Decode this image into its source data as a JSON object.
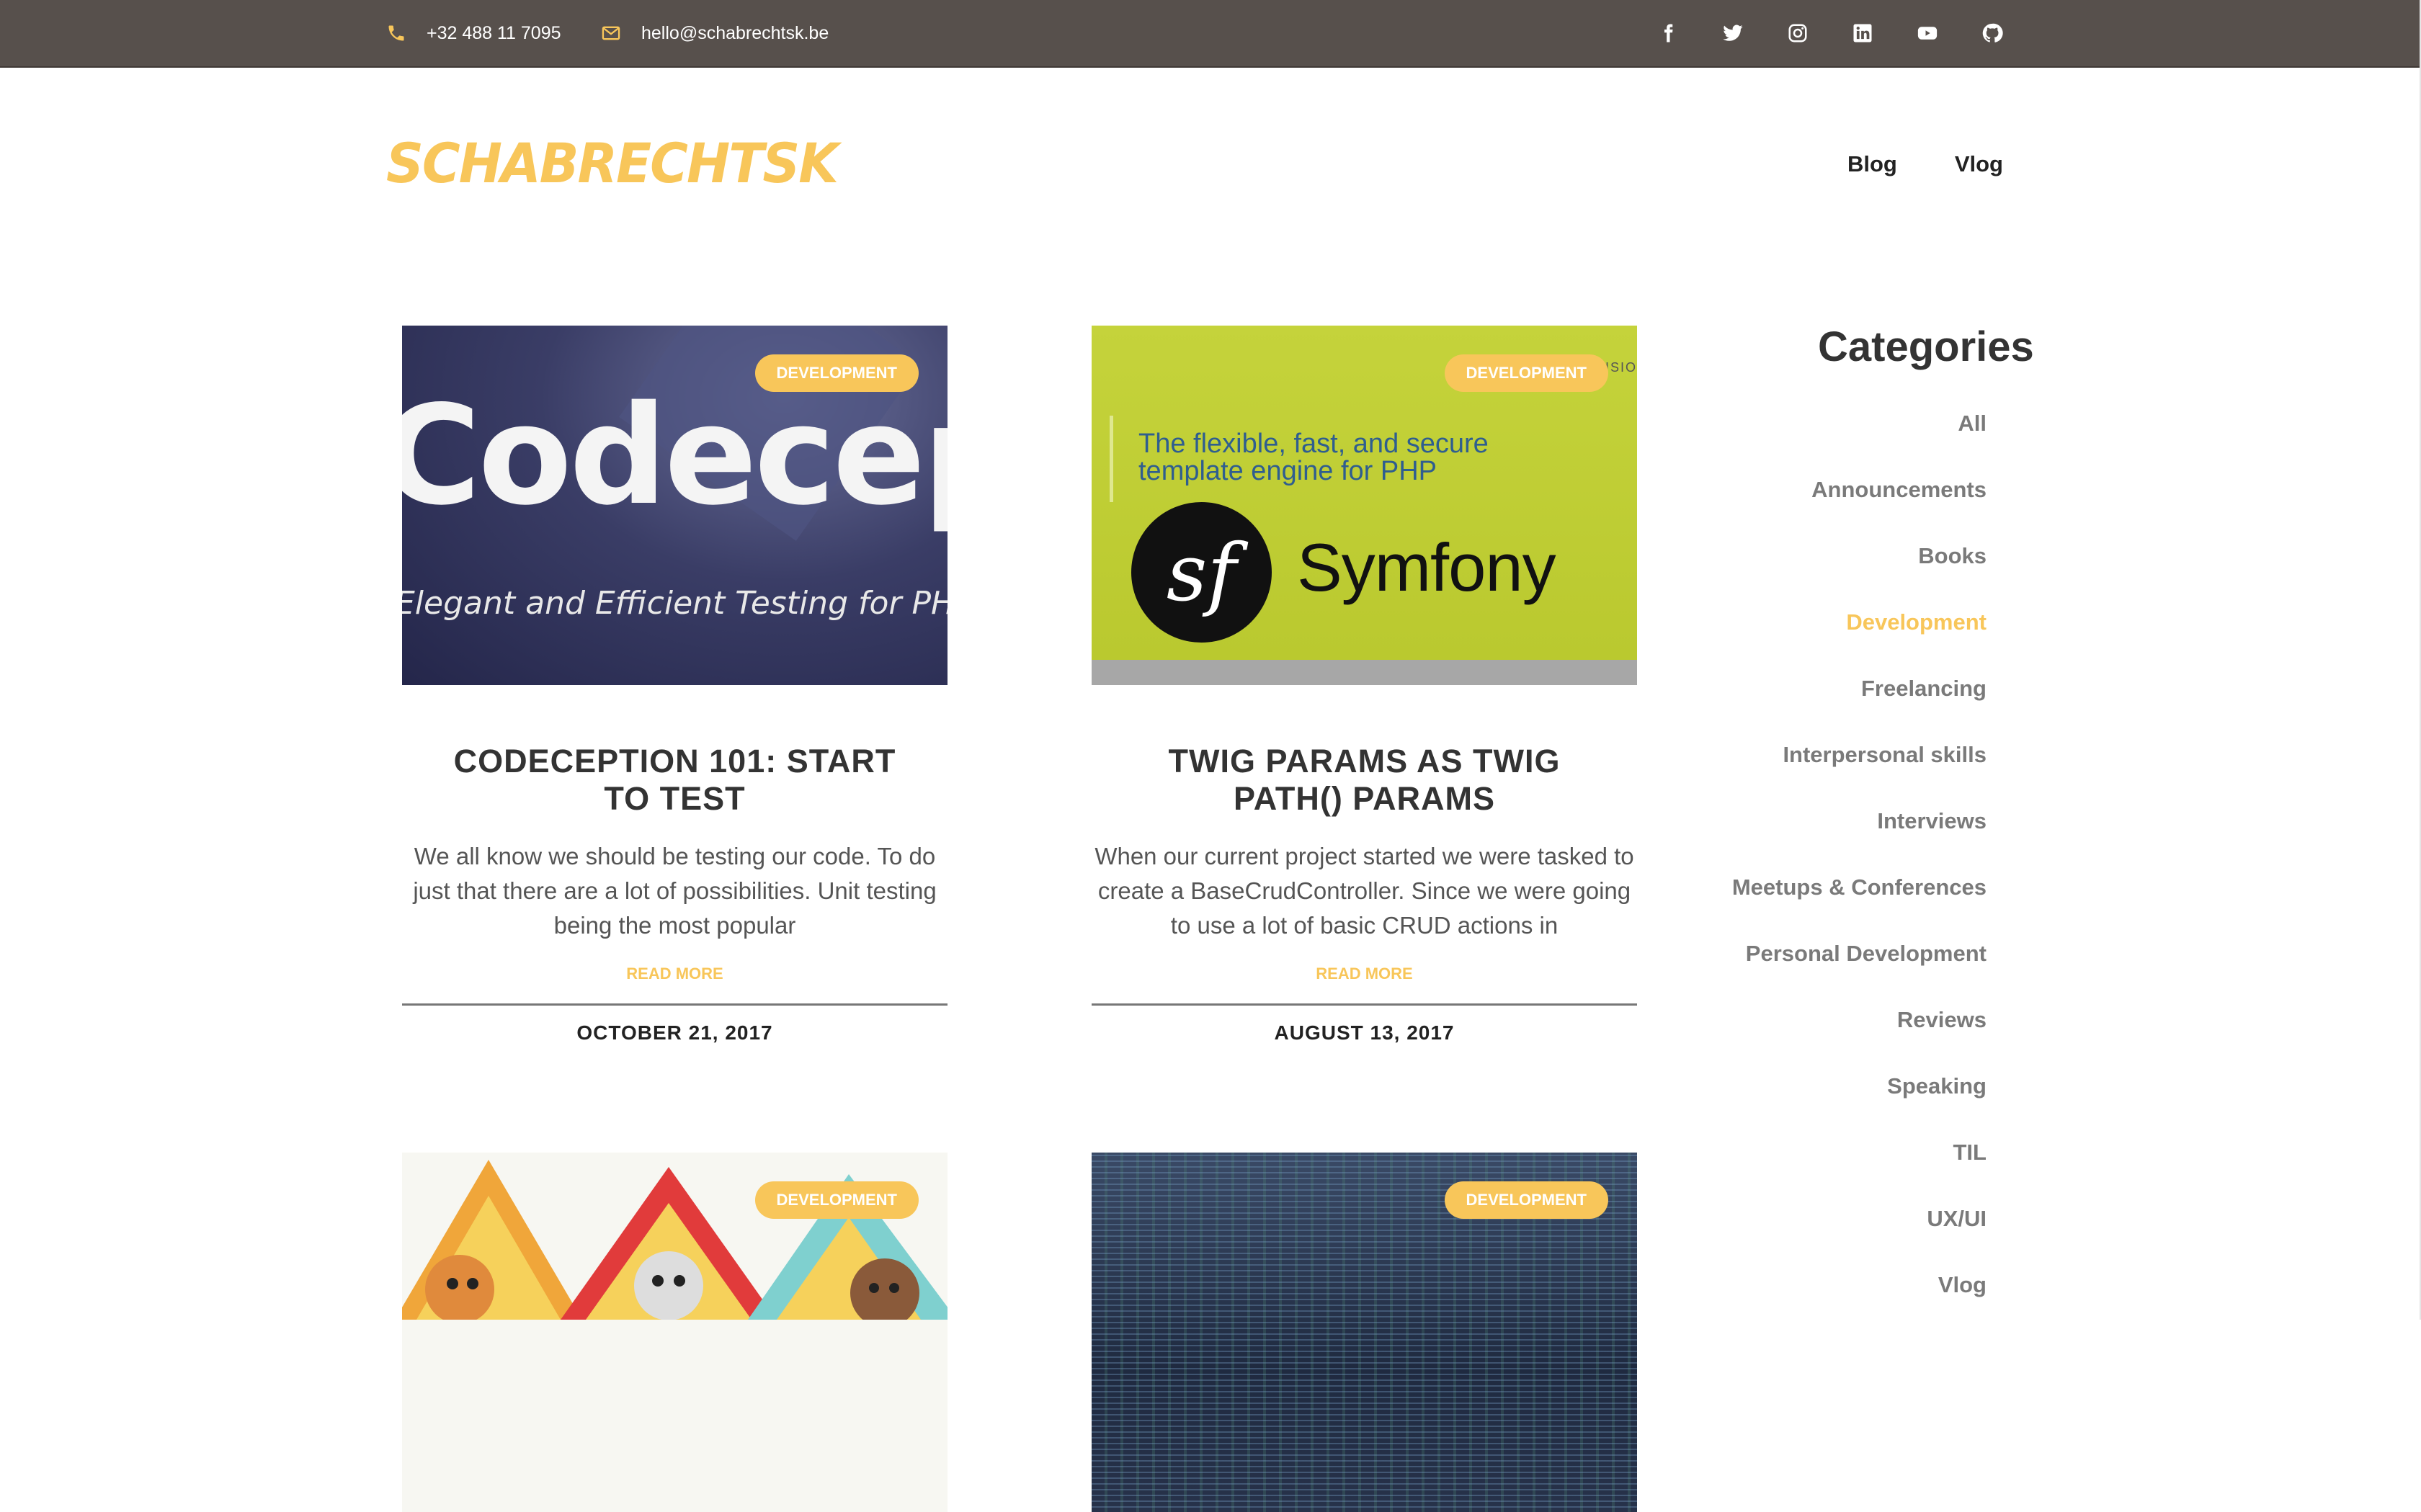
{
  "topbar": {
    "phone": "+32 488 11 7095",
    "email": "hello@schabrechtsk.be",
    "accent_color": "#f8c65a",
    "background_color": "#57504c",
    "social_icons": [
      "facebook-icon",
      "twitter-icon",
      "instagram-icon",
      "linkedin-icon",
      "youtube-icon",
      "github-icon"
    ]
  },
  "header": {
    "logo": "SCHABRECHTSK",
    "nav": [
      {
        "label": "Blog"
      },
      {
        "label": "Vlog"
      }
    ]
  },
  "posts": [
    {
      "category": "DEVELOPMENT",
      "image_text": "Codecep",
      "image_subtext": "Elegant and Efficient Testing for PHP ~",
      "title": "CODECEPTION 101: START TO TEST",
      "excerpt": "We all know we should be testing our code. To do just that there are a lot of possibilities. Unit testing being the most popular",
      "read_more": "READ MORE",
      "date": "OCTOBER 21, 2017"
    },
    {
      "category": "DEVELOPMENT",
      "image_tagline": "The flexible, fast, and secure template engine for PHP",
      "image_logo": "Symfony",
      "image_logo_mark": "sf",
      "image_edge_text": "ISIO",
      "title": "TWIG PARAMS AS TWIG PATH() PARAMS",
      "excerpt": "When our current project started we were tasked to create a BaseCrudController. Since we were going to use a lot of basic CRUD actions in",
      "read_more": "READ MORE",
      "date": "AUGUST 13, 2017"
    },
    {
      "category": "DEVELOPMENT"
    },
    {
      "category": "DEVELOPMENT"
    }
  ],
  "sidebar": {
    "title": "Categories",
    "items": [
      {
        "label": "All"
      },
      {
        "label": "Announcements"
      },
      {
        "label": "Books"
      },
      {
        "label": "Development"
      },
      {
        "label": "Freelancing"
      },
      {
        "label": "Interpersonal skills"
      },
      {
        "label": "Interviews"
      },
      {
        "label": "Meetups & Conferences"
      },
      {
        "label": "Personal Development"
      },
      {
        "label": "Reviews"
      },
      {
        "label": "Speaking"
      },
      {
        "label": "TIL"
      },
      {
        "label": "UX/UI"
      },
      {
        "label": "Vlog"
      }
    ],
    "active_item": "Development"
  }
}
